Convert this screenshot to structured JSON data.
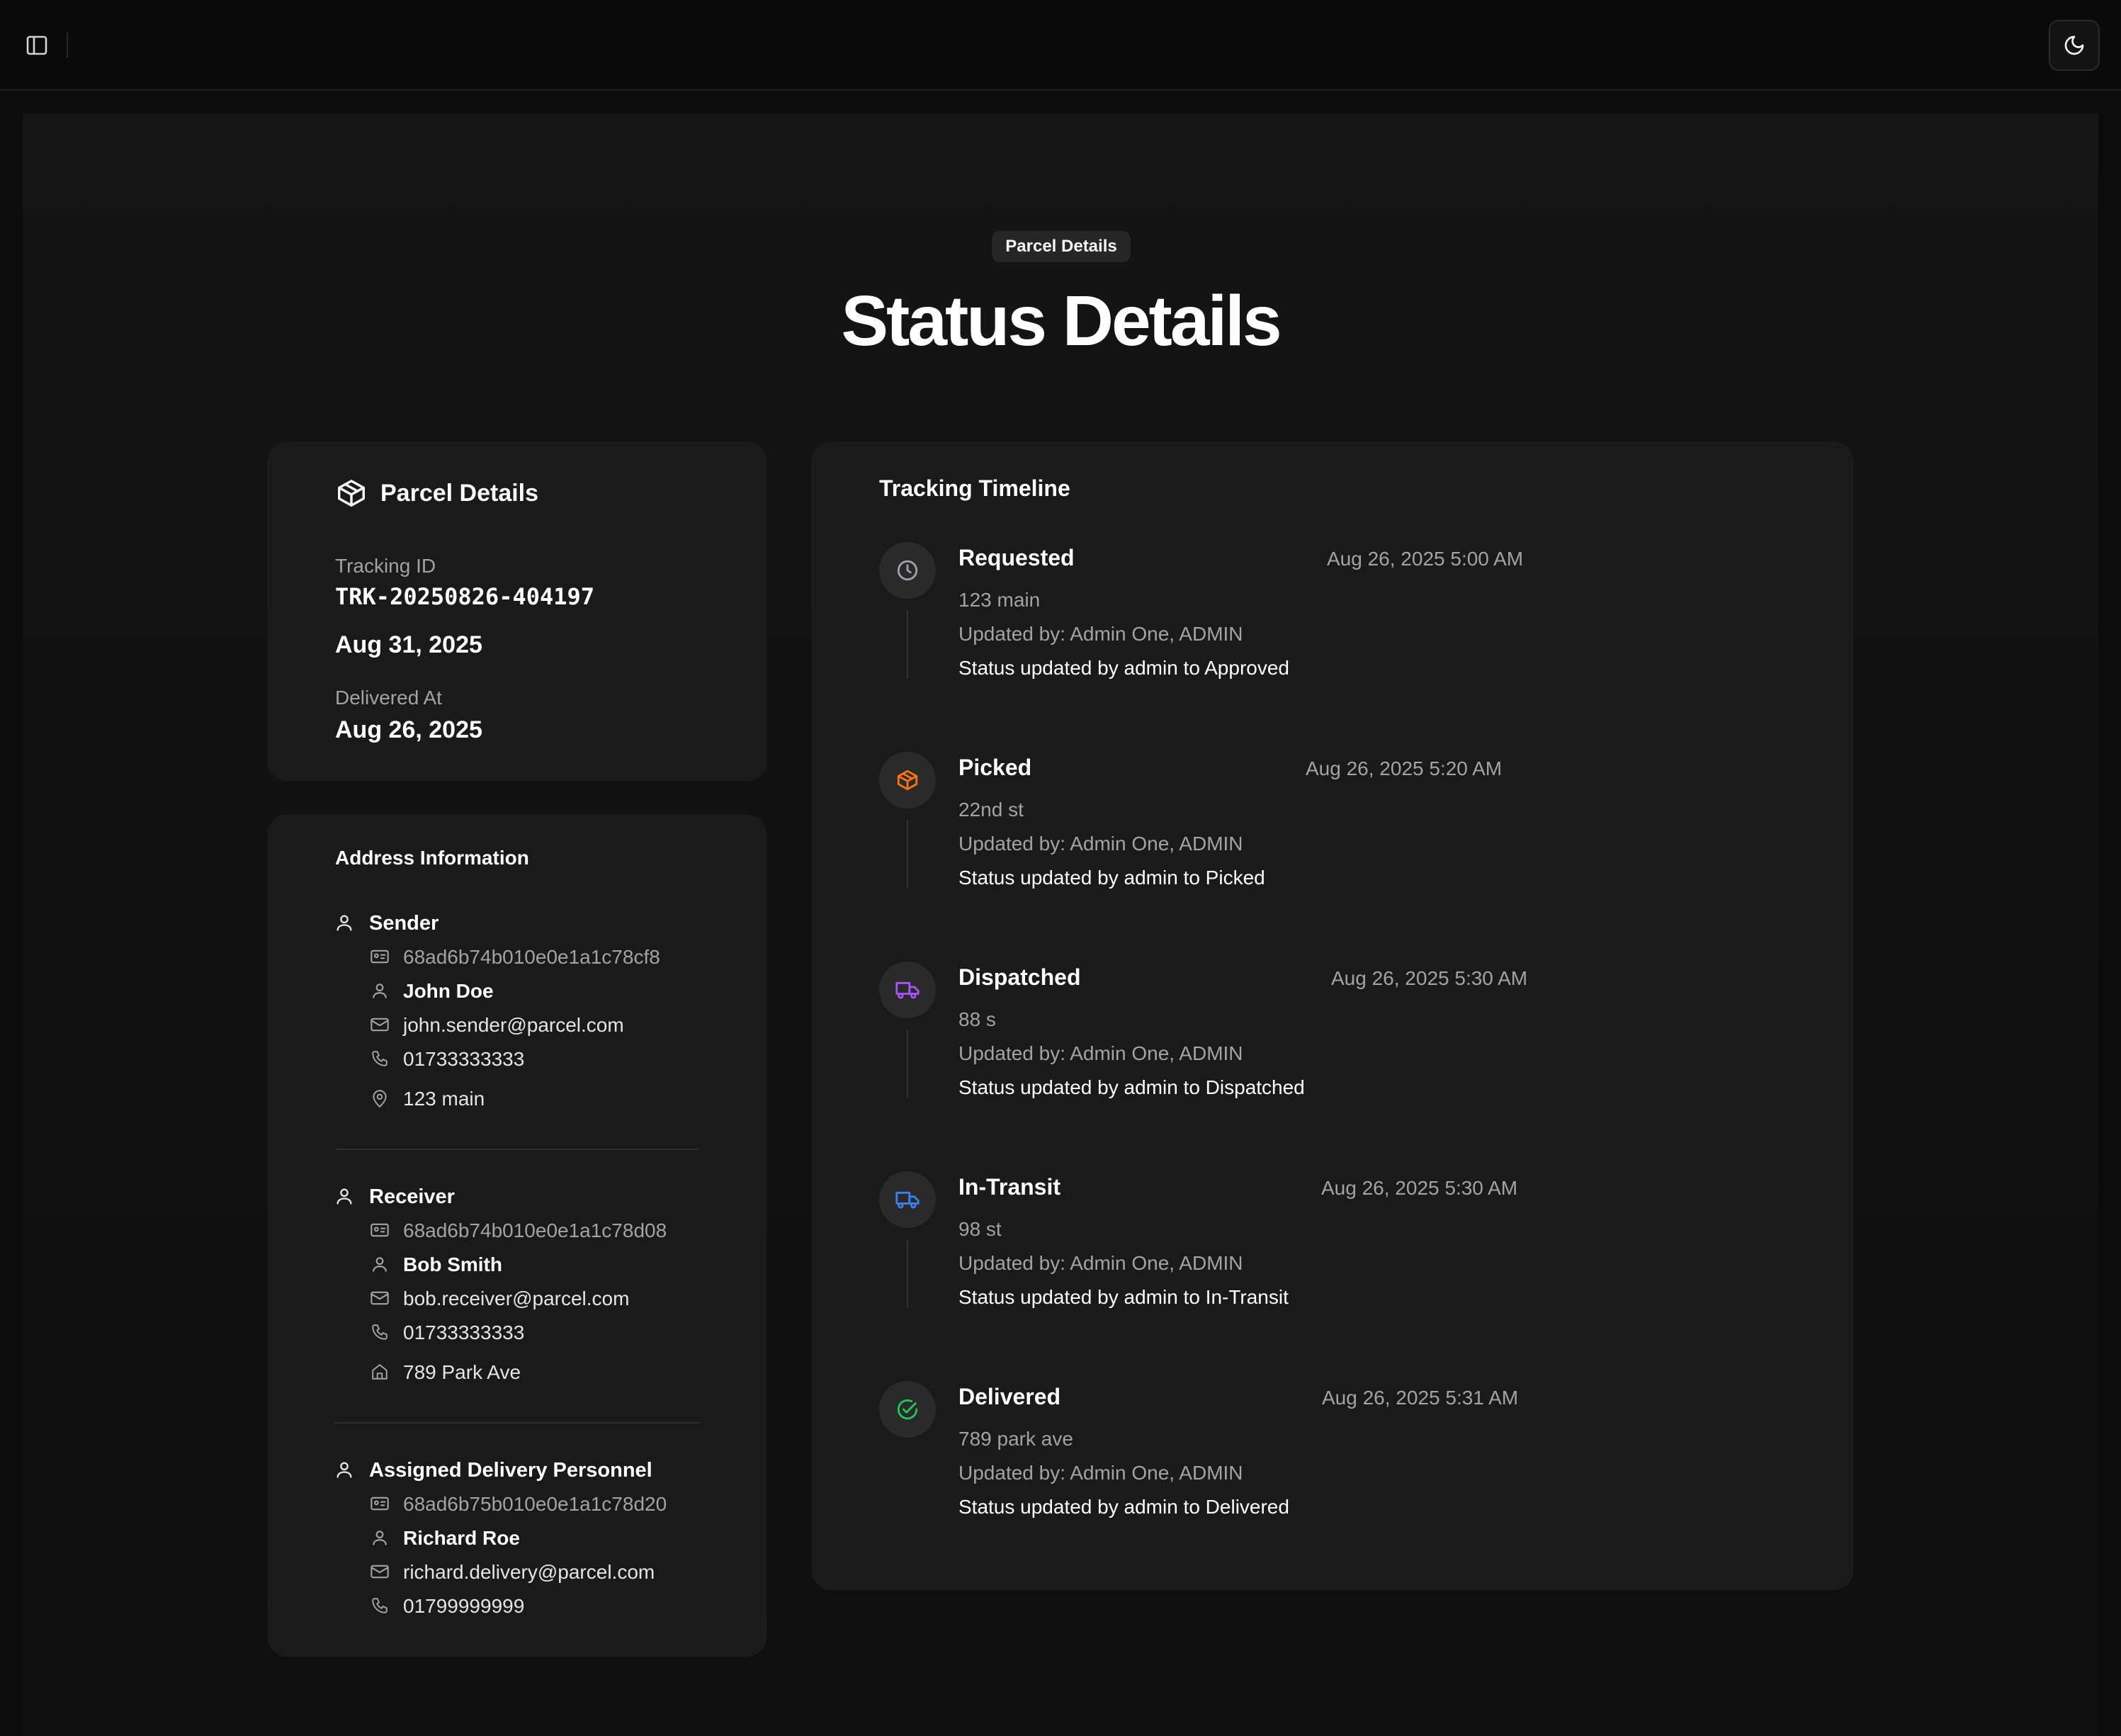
{
  "header": {
    "sidebar_toggle_icon": "sidebar-panel-icon",
    "theme_toggle_icon": "moon-icon"
  },
  "page": {
    "badge": "Parcel Details",
    "title": "Status Details"
  },
  "parcel_card": {
    "heading": "Parcel Details",
    "icon": "package-icon",
    "tracking_label": "Tracking ID",
    "tracking_id": "TRK-20250826-404197",
    "date": "Aug 31, 2025",
    "delivered_label": "Delivered At",
    "delivered_date": "Aug 26, 2025"
  },
  "address_card": {
    "heading": "Address Information",
    "sender": {
      "title": "Sender",
      "id": "68ad6b74b010e0e1a1c78cf8",
      "name": "John Doe",
      "email": "john.sender@parcel.com",
      "phone": "01733333333",
      "address": "123 main"
    },
    "receiver": {
      "title": "Receiver",
      "id": "68ad6b74b010e0e1a1c78d08",
      "name": "Bob Smith",
      "email": "bob.receiver@parcel.com",
      "phone": "01733333333",
      "address": "789 Park Ave"
    },
    "personnel": {
      "title": "Assigned Delivery Personnel",
      "id": "68ad6b75b010e0e1a1c78d20",
      "name": "Richard Roe",
      "email": "richard.delivery@parcel.com",
      "phone": "01799999999"
    }
  },
  "timeline": {
    "heading": "Tracking Timeline",
    "events": [
      {
        "status": "Requested",
        "time": "Aug 26, 2025 5:00 AM",
        "location": "123 main",
        "updated_by": "Updated by: Admin One, ADMIN",
        "note": "Status updated by admin to Approved",
        "icon": "clock-icon",
        "color": "#9ca3af"
      },
      {
        "status": "Picked",
        "time": "Aug 26, 2025 5:20 AM",
        "location": "22nd st",
        "updated_by": "Updated by: Admin One, ADMIN",
        "note": "Status updated by admin to Picked",
        "icon": "package-icon",
        "color": "#f97316"
      },
      {
        "status": "Dispatched",
        "time": "Aug 26, 2025 5:30 AM",
        "location": "88 s",
        "updated_by": "Updated by: Admin One, ADMIN",
        "note": "Status updated by admin to Dispatched",
        "icon": "truck-icon",
        "color": "#a855f7"
      },
      {
        "status": "In-Transit",
        "time": "Aug 26, 2025 5:30 AM",
        "location": "98 st",
        "updated_by": "Updated by: Admin One, ADMIN",
        "note": "Status updated by admin to In-Transit",
        "icon": "truck-icon",
        "color": "#3b82f6"
      },
      {
        "status": "Delivered",
        "time": "Aug 26, 2025 5:31 AM",
        "location": "789 park ave",
        "updated_by": "Updated by: Admin One, ADMIN",
        "note": "Status updated by admin to Delivered",
        "icon": "check-circle-icon",
        "color": "#22c55e"
      }
    ]
  }
}
